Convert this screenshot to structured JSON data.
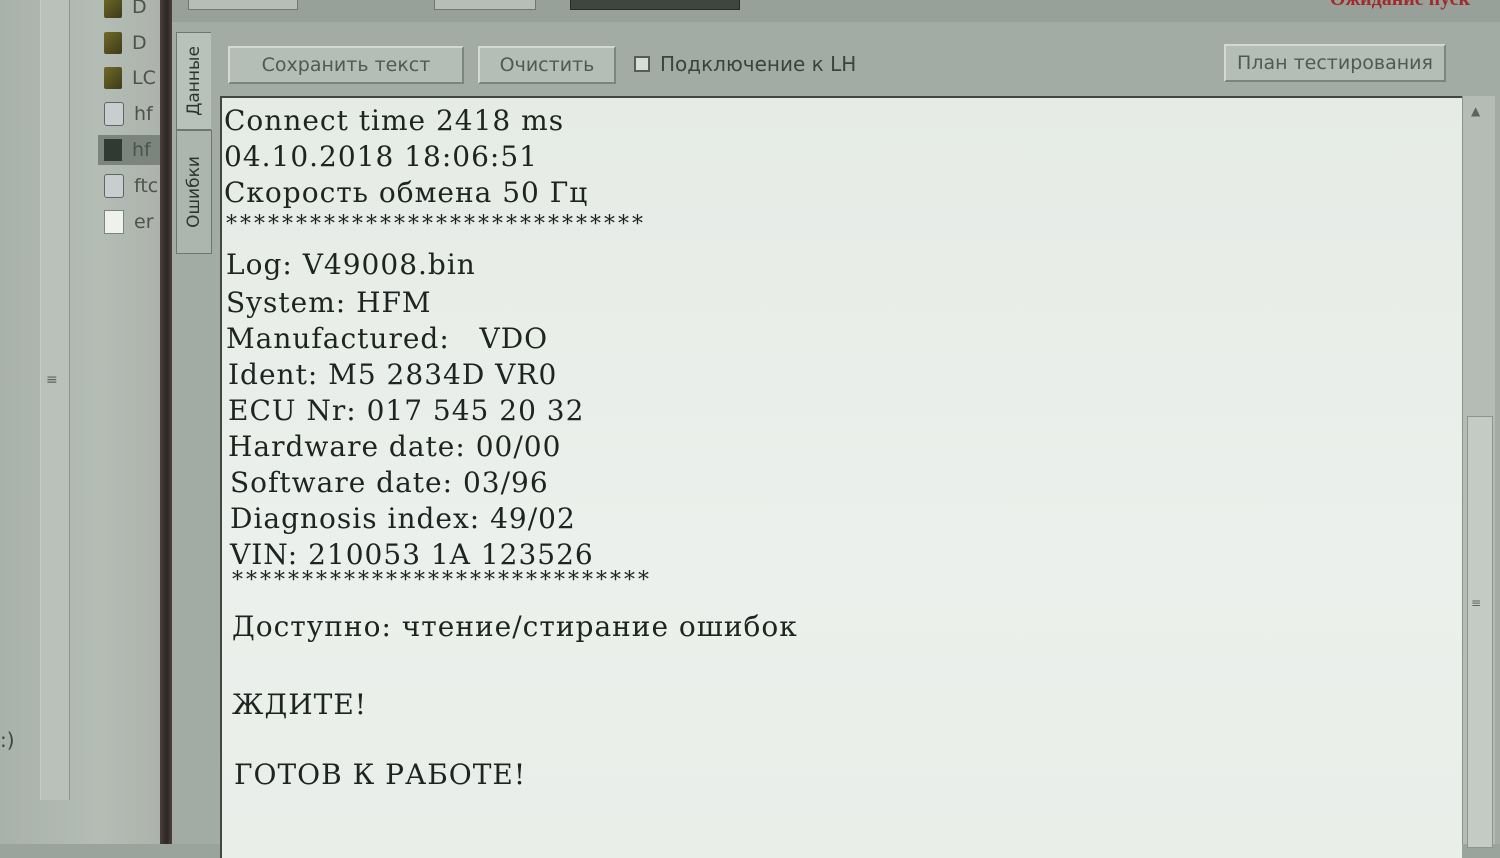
{
  "status": {
    "text": "Ожидание пуск"
  },
  "file_list": [
    {
      "label": "D",
      "icon": "folder-icon"
    },
    {
      "label": "D",
      "icon": "folder-icon"
    },
    {
      "label": "LC",
      "icon": "folder-icon"
    },
    {
      "label": "hf",
      "icon": "settings-file-icon"
    },
    {
      "label": "hf",
      "icon": "app-file-icon"
    },
    {
      "label": "ftc",
      "icon": "link-file-icon"
    },
    {
      "label": "er",
      "icon": "document-icon"
    }
  ],
  "left_footer": ":)",
  "side_tabs": {
    "data": "Данные",
    "errors": "Ошибки"
  },
  "toolbar": {
    "save_text": "Сохранить текст",
    "clear": "Очистить",
    "lh_connection": "Подключение к LH",
    "lh_checked": false,
    "test_plan": "План тестирования"
  },
  "log": {
    "connect_time": "Connect time 2418 ms",
    "datetime": "04.10.2018 18:06:51",
    "speed": "Скорость обмена 50 Гц",
    "sep1": "******************************",
    "log_file": "Log: V49008.bin",
    "system": "System: HFM",
    "manufactured": "Manufactured:   VDO",
    "ident": "Ident: M5 2834D VR0",
    "ecu_nr": "ECU Nr: 017 545 20 32",
    "hardware_date": "Hardware date: 00/00",
    "software_date": "Software date: 03/96",
    "diagnosis_index": "Diagnosis index: 49/02",
    "vin": "VIN: 210053 1A 123526",
    "sep2": "******************************",
    "available": "Доступно: чтение/стирание ошибок",
    "wait": "ЖДИТЕ!",
    "ready": "ГОТОВ К РАБОТЕ!"
  }
}
